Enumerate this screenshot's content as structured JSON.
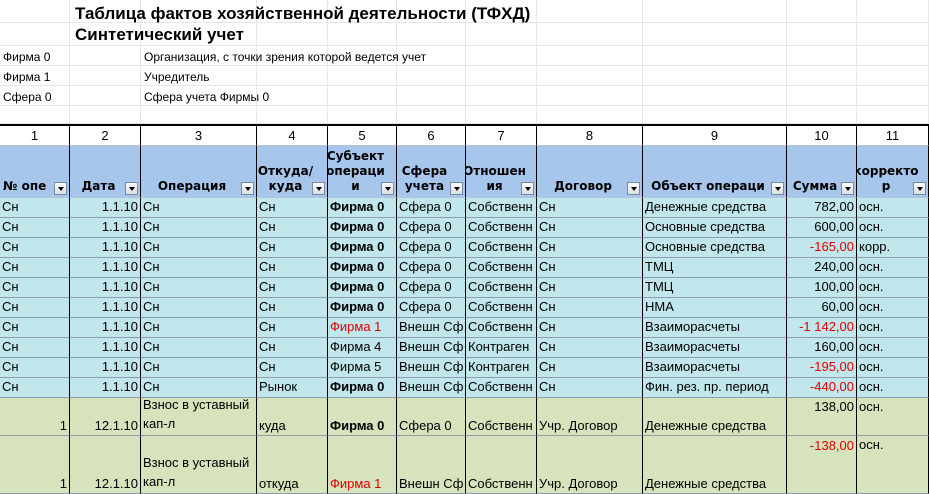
{
  "title_line1": "Таблица фактов хозяйственной деятельности (ТФХД)",
  "title_line2": "Синтетический учет",
  "legend": [
    {
      "key": "Фирма 0",
      "value": "Организация, с точки зрения которой ведется учет"
    },
    {
      "key": "Фирма 1",
      "value": "Учредитель"
    },
    {
      "key": "Сфера 0",
      "value": "Сфера учета Фирмы 0"
    }
  ],
  "column_numbers": [
    "1",
    "2",
    "3",
    "4",
    "5",
    "6",
    "7",
    "8",
    "9",
    "10",
    "11"
  ],
  "headers": [
    "№ опе",
    "Дата",
    "Операция",
    "Откуда/ куда",
    "Субъект операци и",
    "Сфера учета",
    "Отношен ия",
    "Договор",
    "Объект операци",
    "Сумма",
    "корректо р"
  ],
  "colors": {
    "header_bg": "#a6c6ec",
    "row_blue": "#c1e6ec",
    "row_green": "#d6e3bc",
    "grid": "#b7c3d6",
    "negative": "#e00000"
  },
  "rows": [
    [
      "Сн",
      "1.1.10",
      "Сн",
      "Сн",
      "Фирма 0",
      "Сфера 0",
      "Собственн",
      "Сн",
      "Денежные средства",
      "782,00",
      "осн."
    ],
    [
      "Сн",
      "1.1.10",
      "Сн",
      "Сн",
      "Фирма 0",
      "Сфера 0",
      "Собственн",
      "Сн",
      "Основные средства",
      "600,00",
      "осн."
    ],
    [
      "Сн",
      "1.1.10",
      "Сн",
      "Сн",
      "Фирма 0",
      "Сфера 0",
      "Собственн",
      "Сн",
      "Основные средства",
      "-165,00",
      "корр."
    ],
    [
      "Сн",
      "1.1.10",
      "Сн",
      "Сн",
      "Фирма 0",
      "Сфера 0",
      "Собственн",
      "Сн",
      "ТМЦ",
      "240,00",
      "осн."
    ],
    [
      "Сн",
      "1.1.10",
      "Сн",
      "Сн",
      "Фирма 0",
      "Сфера 0",
      "Собственн",
      "Сн",
      "ТМЦ",
      "100,00",
      "осн."
    ],
    [
      "Сн",
      "1.1.10",
      "Сн",
      "Сн",
      "Фирма 0",
      "Сфера 0",
      "Собственн",
      "Сн",
      "НМА",
      "60,00",
      "осн."
    ],
    [
      "Сн",
      "1.1.10",
      "Сн",
      "Сн",
      "Фирма 1",
      "Внешн Сф",
      "Собственн",
      "Сн",
      "Взаиморасчеты",
      "-1 142,00",
      "осн."
    ],
    [
      "Сн",
      "1.1.10",
      "Сн",
      "Сн",
      "Фирма 4",
      "Внешн Сф",
      "Контраген",
      "Сн",
      "Взаиморасчеты",
      "160,00",
      "осн."
    ],
    [
      "Сн",
      "1.1.10",
      "Сн",
      "Сн",
      "Фирма 5",
      "Внешн Сф",
      "Контраген",
      "Сн",
      "Взаиморасчеты",
      "-195,00",
      "осн."
    ],
    [
      "Сн",
      "1.1.10",
      "Сн",
      "Рынок",
      "Фирма 0",
      "Внешн Сф",
      "Собственн",
      "Сн",
      "Фин. рез. пр. период",
      "-440,00",
      "осн."
    ],
    [
      "1",
      "12.1.10",
      "Взнос в уставный кап-л",
      "куда",
      "Фирма 0",
      "Сфера 0",
      "Собственн",
      "Учр. Договор",
      "Денежные средства",
      "138,00",
      "осн."
    ],
    [
      "1",
      "12.1.10",
      "Взнос в уставный кап-л",
      "откуда",
      "Фирма 1",
      "Внешн Сф",
      "Собственн",
      "Учр. Договор",
      "Денежные средства",
      "-138,00",
      "осн."
    ]
  ]
}
